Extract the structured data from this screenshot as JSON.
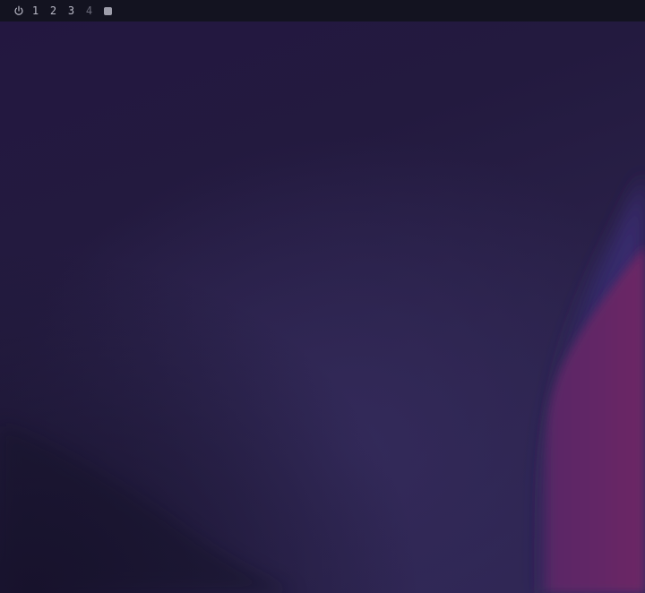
{
  "topbar": {
    "power_icon": "power-icon",
    "workspaces": [
      {
        "label": "1",
        "state": "occupied"
      },
      {
        "label": "2",
        "state": "occupied"
      },
      {
        "label": "3",
        "state": "occupied"
      },
      {
        "label": "4",
        "state": "empty"
      }
    ],
    "active_indicator": "filled-square-icon"
  },
  "colors": {
    "bar_background": "#131320",
    "wallpaper_base": "#231a3f",
    "wallpaper_accent": "#6a2665"
  }
}
